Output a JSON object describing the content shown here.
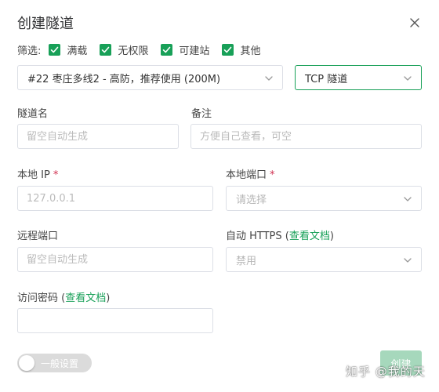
{
  "dialog": {
    "title": "创建隧道"
  },
  "filters": {
    "label": "筛选:",
    "options": [
      {
        "label": "满载",
        "checked": true
      },
      {
        "label": "无权限",
        "checked": true
      },
      {
        "label": "可建站",
        "checked": true
      },
      {
        "label": "其他",
        "checked": true
      }
    ]
  },
  "node_select": {
    "value": "#22 枣庄多线2 - 高防，推荐使用 (200M)"
  },
  "protocol_select": {
    "value": "TCP 隧道"
  },
  "tunnel_name": {
    "label": "隧道名",
    "placeholder": "留空自动生成"
  },
  "remark": {
    "label": "备注",
    "placeholder": "方便自己查看，可空"
  },
  "local_ip": {
    "label": "本地 IP",
    "required": "*",
    "placeholder": "127.0.0.1"
  },
  "local_port": {
    "label": "本地端口",
    "required": "*",
    "placeholder": "请选择"
  },
  "remote_port": {
    "label": "远程端口",
    "placeholder": "留空自动生成"
  },
  "auto_https": {
    "label": "自动 HTTPS",
    "open_paren": " (",
    "link": "查看文档",
    "close_paren": ")",
    "value": "禁用"
  },
  "access_password": {
    "label": "访问密码",
    "open_paren": " (",
    "link": "查看文档",
    "close_paren": ")",
    "value": ""
  },
  "general_settings": {
    "label": "一般设置",
    "enabled": false
  },
  "create_button": {
    "label": "创建"
  },
  "watermark": {
    "text": "知乎 @我的天"
  },
  "colors": {
    "accent": "#18a058",
    "required": "#d03050",
    "border": "#dcdfe6",
    "button_disabled": "#a6d8bc"
  }
}
